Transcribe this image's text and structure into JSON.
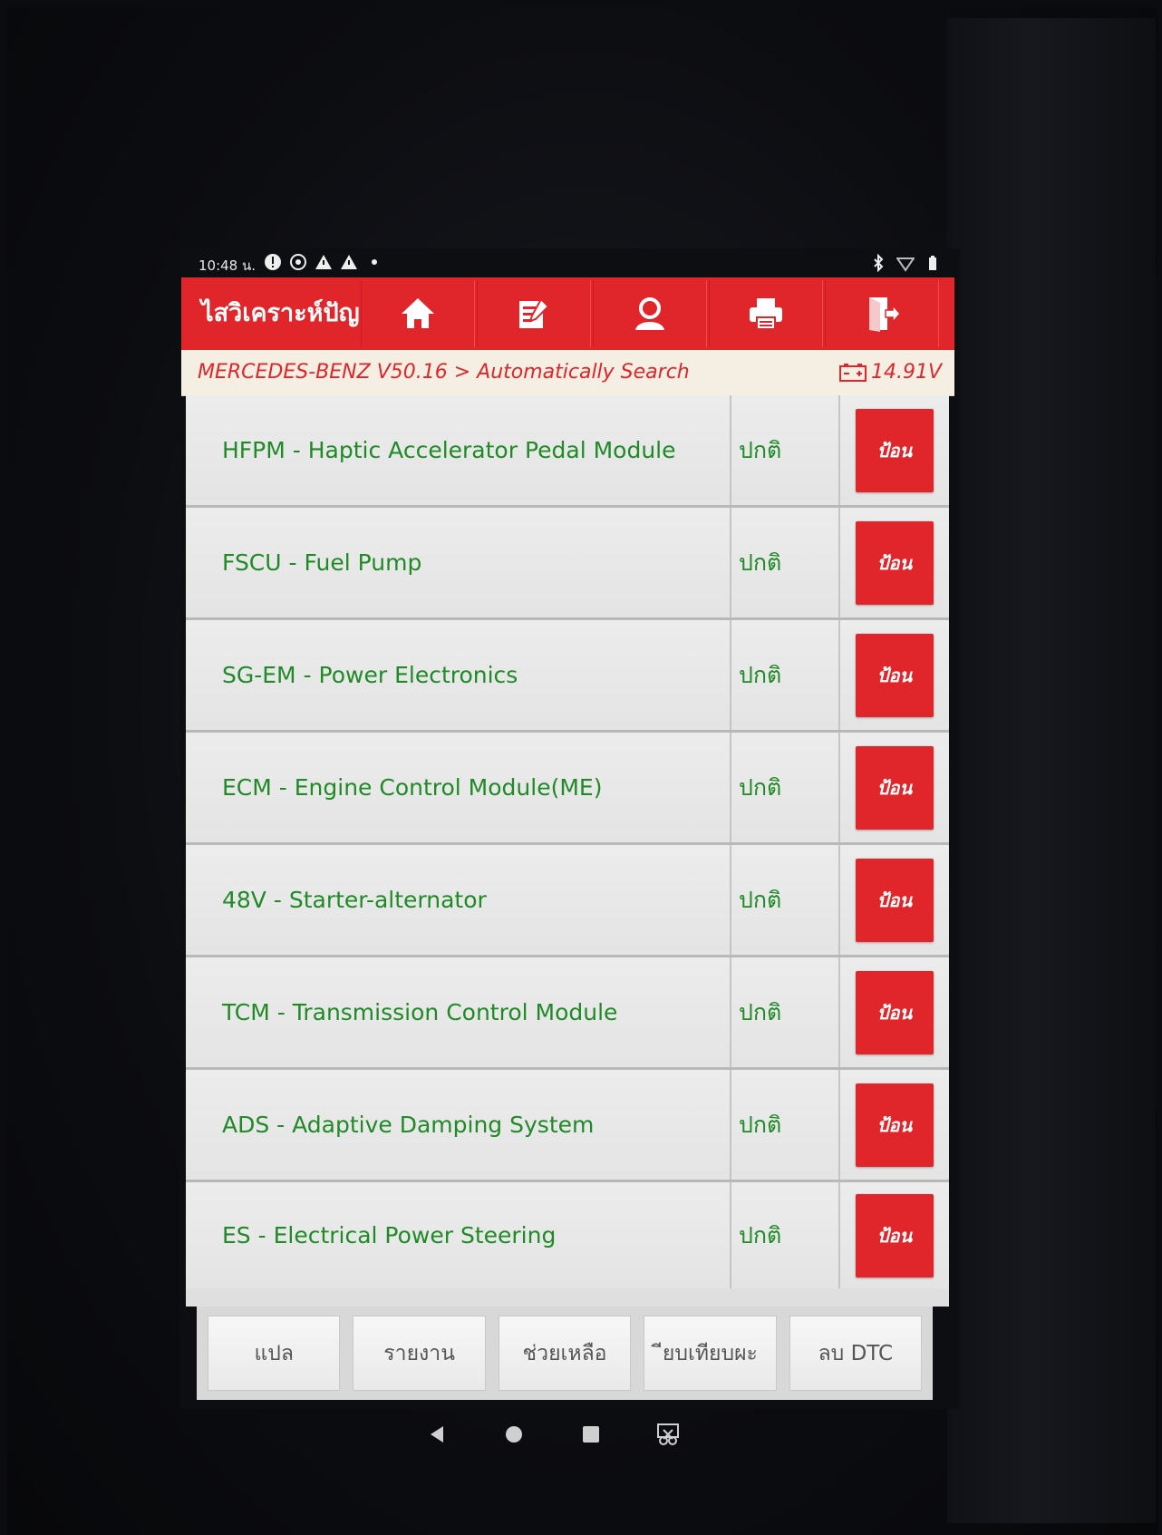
{
  "status_bar": {
    "time": "10:48 น."
  },
  "header": {
    "title": "ไสวิเคราะห์ปัญ",
    "icons": [
      "home-icon",
      "edit-report-icon",
      "user-profile-icon",
      "print-icon",
      "exit-icon"
    ]
  },
  "breadcrumb": {
    "path": "MERCEDES-BENZ V50.16 > Automatically Search",
    "voltage": "14.91V"
  },
  "modules": [
    {
      "name": "HFPM - Haptic Accelerator Pedal Module",
      "status": "ปกติ",
      "action": "ป้อน"
    },
    {
      "name": "FSCU - Fuel Pump",
      "status": "ปกติ",
      "action": "ป้อน"
    },
    {
      "name": "SG-EM - Power Electronics",
      "status": "ปกติ",
      "action": "ป้อน"
    },
    {
      "name": "ECM - Engine Control Module(ME)",
      "status": "ปกติ",
      "action": "ป้อน"
    },
    {
      "name": "48V - Starter-alternator",
      "status": "ปกติ",
      "action": "ป้อน"
    },
    {
      "name": "TCM - Transmission Control Module",
      "status": "ปกติ",
      "action": "ป้อน"
    },
    {
      "name": "ADS - Adaptive Damping System",
      "status": "ปกติ",
      "action": "ป้อน"
    },
    {
      "name": "ES - Electrical Power Steering",
      "status": "ปกติ",
      "action": "ป้อน"
    }
  ],
  "function_bar": {
    "translate": "แปล",
    "report": "รายงาน",
    "help": "ช่วยเหลือ",
    "compare": "ียบเทียบผะ",
    "clear_dtc": "ลบ DTC"
  },
  "colors": {
    "brand_red": "#e0262b",
    "text_green": "#1f8a26",
    "breadcrumb_bg": "#f4efe2"
  }
}
